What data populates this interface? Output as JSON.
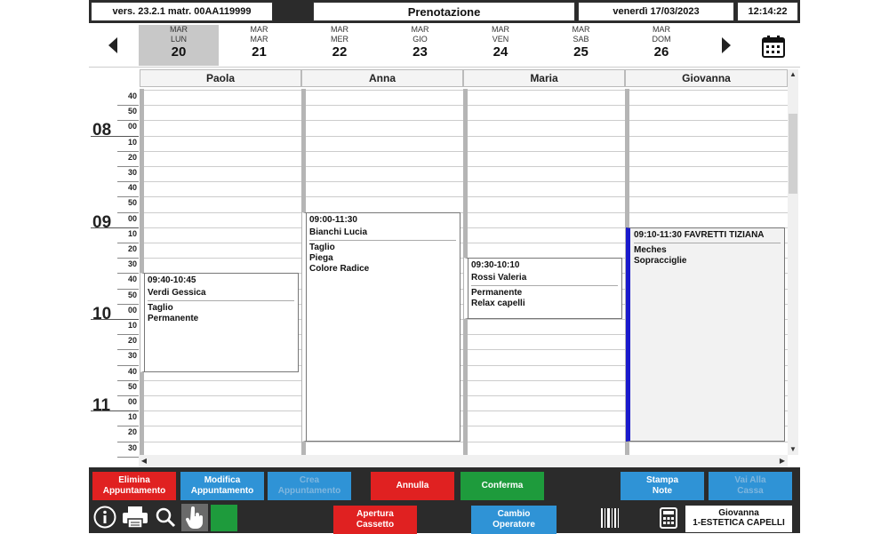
{
  "topbar": {
    "version": "vers. 23.2.1 matr. 00AA119999",
    "title": "Prenotazione",
    "date": "venerdì 17/03/2023",
    "time": "12:14:22"
  },
  "days": [
    {
      "month": "MAR",
      "weekday": "LUN",
      "num": "20",
      "selected": true
    },
    {
      "month": "MAR",
      "weekday": "MAR",
      "num": "21"
    },
    {
      "month": "MAR",
      "weekday": "MER",
      "num": "22"
    },
    {
      "month": "MAR",
      "weekday": "GIO",
      "num": "23"
    },
    {
      "month": "MAR",
      "weekday": "VEN",
      "num": "24"
    },
    {
      "month": "MAR",
      "weekday": "SAB",
      "num": "25"
    },
    {
      "month": "MAR",
      "weekday": "DOM",
      "num": "26"
    }
  ],
  "operators": [
    "Paola",
    "Anna",
    "Maria",
    "Giovanna"
  ],
  "timeaxis": [
    {
      "min": "40"
    },
    {
      "min": "50"
    },
    {
      "hour": "08",
      "min": "00"
    },
    {
      "min": "10"
    },
    {
      "min": "20"
    },
    {
      "min": "30"
    },
    {
      "min": "40"
    },
    {
      "min": "50"
    },
    {
      "hour": "09",
      "min": "00"
    },
    {
      "min": "10"
    },
    {
      "min": "20"
    },
    {
      "min": "30"
    },
    {
      "min": "40"
    },
    {
      "min": "50"
    },
    {
      "hour": "10",
      "min": "00"
    },
    {
      "min": "10"
    },
    {
      "min": "20"
    },
    {
      "min": "30"
    },
    {
      "min": "40"
    },
    {
      "min": "50"
    },
    {
      "hour": "11",
      "min": "00"
    },
    {
      "min": "10"
    },
    {
      "min": "20"
    },
    {
      "min": "30"
    }
  ],
  "appointments": [
    {
      "operator": 0,
      "start": "09:40",
      "end": "10:45",
      "header": "09:40-10:45",
      "client": "Verdi Gessica",
      "services": [
        "Taglio",
        "Permanente"
      ]
    },
    {
      "operator": 1,
      "start": "09:00",
      "end": "11:30",
      "header": "09:00-11:30",
      "client": "Bianchi Lucia",
      "services": [
        "Taglio",
        "Piega",
        "Colore Radice"
      ]
    },
    {
      "operator": 2,
      "start": "09:30",
      "end": "10:10",
      "header": "09:30-10:10",
      "client": "Rossi Valeria",
      "services": [
        "Permanente",
        "Relax capelli"
      ]
    },
    {
      "operator": 3,
      "start": "09:10",
      "end": "11:30",
      "header": "09:10-11:30 FAVRETTI TIZIANA",
      "client": "",
      "services": [
        "Meches",
        "Sopracciglie"
      ],
      "accent": "#1a1acc"
    }
  ],
  "toolbar": {
    "elimina": "Elimina\nAppuntamento",
    "modifica": "Modifica\nAppuntamento",
    "crea": "Crea\nAppuntamento",
    "annulla": "Annulla",
    "conferma": "Conferma",
    "stampa": "Stampa\nNote",
    "vai": "Vai Alla\nCassa",
    "apertura": "Apertura\nCassetto",
    "cambio": "Cambio\nOperatore",
    "operator_name": "Giovanna",
    "operator_role": "1-ESTETICA CAPELLI"
  },
  "colors": {
    "red": "#e02121",
    "blue": "#2f93d6",
    "green": "#1e9b3c",
    "accent": "#1a1acc"
  }
}
